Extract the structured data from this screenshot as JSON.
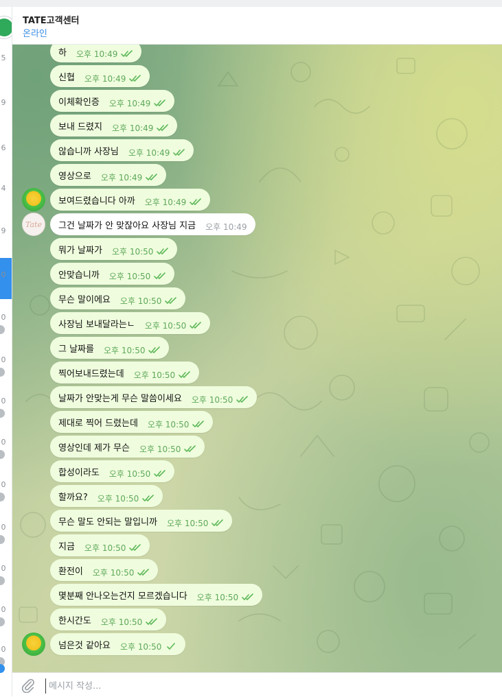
{
  "chat": {
    "title": "TATE고객센터",
    "status": "온라인"
  },
  "sidebar": {
    "numbers": [
      "5",
      "9",
      "6",
      "4",
      "9",
      "0",
      "0",
      "0",
      "0",
      "0",
      "0",
      "0",
      "0",
      "0",
      "0",
      "0",
      "9",
      "0"
    ]
  },
  "messages": [
    {
      "text": "하",
      "time": "오후 10:49",
      "side": "out",
      "read": true
    },
    {
      "text": "신협",
      "time": "오후 10:49",
      "side": "out",
      "read": true
    },
    {
      "text": "이체확인증",
      "time": "오후 10:49",
      "side": "out",
      "read": true
    },
    {
      "text": "보내 드렸지",
      "time": "오후 10:49",
      "side": "out",
      "read": true
    },
    {
      "text": "않습니까 사장님",
      "time": "오후 10:49",
      "side": "out",
      "read": true
    },
    {
      "text": "영상으로",
      "time": "오후 10:49",
      "side": "out",
      "read": true
    },
    {
      "text": "보여드렸습니다 아까",
      "time": "오후 10:49",
      "side": "out",
      "read": true,
      "avatar": "emoji-avatar"
    },
    {
      "text": "그건 날짜가 안 맞잖아요 사장님 지금",
      "time": "오후 10:49",
      "side": "in",
      "avatar": "tate-avatar"
    },
    {
      "text": "뭐가 날짜가",
      "time": "오후 10:50",
      "side": "out",
      "read": true
    },
    {
      "text": "안맞습니까",
      "time": "오후 10:50",
      "side": "out",
      "read": true
    },
    {
      "text": "무슨 말이에요",
      "time": "오후 10:50",
      "side": "out",
      "read": true
    },
    {
      "text": "사장님 보내달라는ㄴ",
      "time": "오후 10:50",
      "side": "out",
      "read": true
    },
    {
      "text": "그 날짜를",
      "time": "오후 10:50",
      "side": "out",
      "read": true
    },
    {
      "text": "찍어보내드렸는데",
      "time": "오후 10:50",
      "side": "out",
      "read": true
    },
    {
      "text": "날짜가 안맞는게 무슨 말씀이세요",
      "time": "오후 10:50",
      "side": "out",
      "read": true
    },
    {
      "text": "제대로 찍어 드렸는데",
      "time": "오후 10:50",
      "side": "out",
      "read": true
    },
    {
      "text": "영상인데 제가 무슨",
      "time": "오후 10:50",
      "side": "out",
      "read": true
    },
    {
      "text": "합성이라도",
      "time": "오후 10:50",
      "side": "out",
      "read": true
    },
    {
      "text": "할까요?",
      "time": "오후 10:50",
      "side": "out",
      "read": true
    },
    {
      "text": "무슨 말도 안되는 말입니까",
      "time": "오후 10:50",
      "side": "out",
      "read": true
    },
    {
      "text": "지금",
      "time": "오후 10:50",
      "side": "out",
      "read": true
    },
    {
      "text": "환전이",
      "time": "오후 10:50",
      "side": "out",
      "read": true
    },
    {
      "text": "몇분째 안나오는건지 모르겠습니다",
      "time": "오후 10:50",
      "side": "out",
      "read": true
    },
    {
      "text": "한시간도",
      "time": "오후 10:50",
      "side": "out",
      "read": true
    },
    {
      "text": "넘은것 같아요",
      "time": "오후 10:50",
      "side": "out",
      "read": false,
      "avatar": "emoji-avatar"
    }
  ],
  "composer": {
    "placeholder": "메시지 작성..."
  },
  "icons": {
    "attach": "paperclip-icon",
    "read_ticks": "double-check-icon",
    "sent_tick": "single-check-icon"
  },
  "colors": {
    "outgoing_bubble": "#effdde",
    "incoming_bubble": "#ffffff",
    "time_outgoing": "#5fa85a",
    "accent": "#3390ec"
  }
}
